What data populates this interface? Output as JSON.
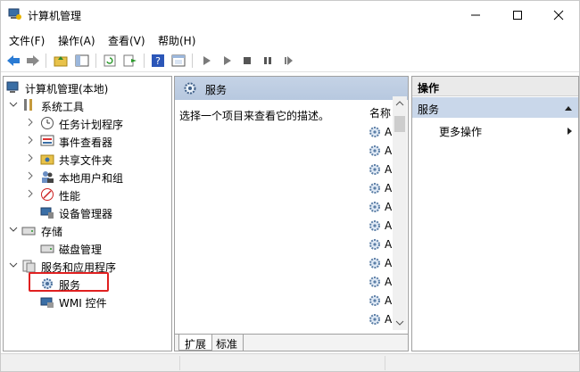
{
  "window": {
    "title": "计算机管理",
    "controls": {
      "minimize": "—",
      "maximize": "☐",
      "close": "✕"
    }
  },
  "menu": [
    "文件(F)",
    "操作(A)",
    "查看(V)",
    "帮助(H)"
  ],
  "tree": {
    "root": "计算机管理(本地)",
    "system_tools": "系统工具",
    "system_items": [
      "任务计划程序",
      "事件查看器",
      "共享文件夹",
      "本地用户和组",
      "性能",
      "设备管理器"
    ],
    "storage": "存储",
    "storage_items": [
      "磁盘管理"
    ],
    "services_apps": "服务和应用程序",
    "services_items": [
      "服务",
      "WMI 控件"
    ]
  },
  "middle": {
    "header": "服务",
    "description": "选择一个项目来查看它的描述。",
    "column": "名称",
    "row_prefix": "A",
    "tabs": [
      "扩展",
      "标准"
    ]
  },
  "actions": {
    "header": "操作",
    "section": "服务",
    "more": "更多操作"
  },
  "colors": {
    "accent_header": "#c5d3e6",
    "selection_border": "#e02020"
  }
}
